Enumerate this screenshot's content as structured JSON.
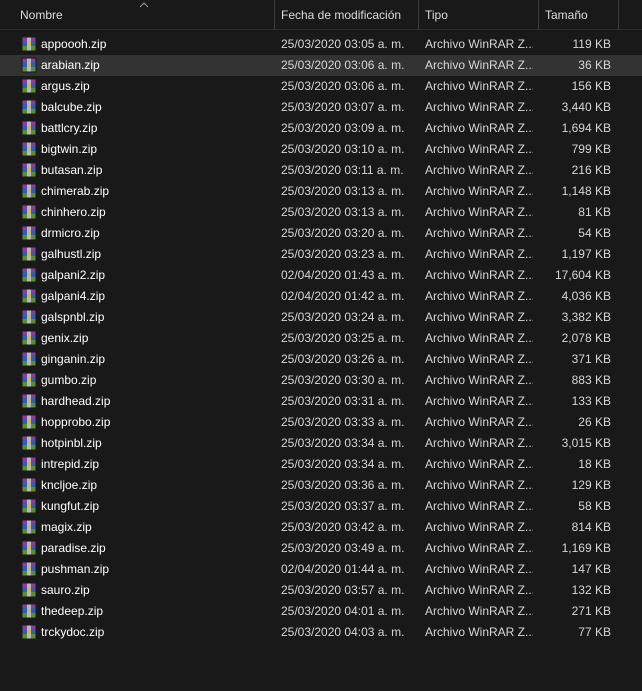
{
  "columns": {
    "name": "Nombre",
    "date": "Fecha de modificación",
    "type": "Tipo",
    "size": "Tamaño"
  },
  "sort": {
    "column": "name",
    "direction": "ascending",
    "icon": "chevron-up-icon"
  },
  "file_icon": "winrar-archive-icon",
  "selected_index": 1,
  "files": [
    {
      "name": "appoooh.zip",
      "date": "25/03/2020 03:05 a. m.",
      "type": "Archivo WinRAR Z...",
      "size": "119 KB"
    },
    {
      "name": "arabian.zip",
      "date": "25/03/2020 03:06 a. m.",
      "type": "Archivo WinRAR Z...",
      "size": "36 KB"
    },
    {
      "name": "argus.zip",
      "date": "25/03/2020 03:06 a. m.",
      "type": "Archivo WinRAR Z...",
      "size": "156 KB"
    },
    {
      "name": "balcube.zip",
      "date": "25/03/2020 03:07 a. m.",
      "type": "Archivo WinRAR Z...",
      "size": "3,440 KB"
    },
    {
      "name": "battlcry.zip",
      "date": "25/03/2020 03:09 a. m.",
      "type": "Archivo WinRAR Z...",
      "size": "1,694 KB"
    },
    {
      "name": "bigtwin.zip",
      "date": "25/03/2020 03:10 a. m.",
      "type": "Archivo WinRAR Z...",
      "size": "799 KB"
    },
    {
      "name": "butasan.zip",
      "date": "25/03/2020 03:11 a. m.",
      "type": "Archivo WinRAR Z...",
      "size": "216 KB"
    },
    {
      "name": "chimerab.zip",
      "date": "25/03/2020 03:13 a. m.",
      "type": "Archivo WinRAR Z...",
      "size": "1,148 KB"
    },
    {
      "name": "chinhero.zip",
      "date": "25/03/2020 03:13 a. m.",
      "type": "Archivo WinRAR Z...",
      "size": "81 KB"
    },
    {
      "name": "drmicro.zip",
      "date": "25/03/2020 03:20 a. m.",
      "type": "Archivo WinRAR Z...",
      "size": "54 KB"
    },
    {
      "name": "galhustl.zip",
      "date": "25/03/2020 03:23 a. m.",
      "type": "Archivo WinRAR Z...",
      "size": "1,197 KB"
    },
    {
      "name": "galpani2.zip",
      "date": "02/04/2020 01:43 a. m.",
      "type": "Archivo WinRAR Z...",
      "size": "17,604 KB"
    },
    {
      "name": "galpani4.zip",
      "date": "02/04/2020 01:42 a. m.",
      "type": "Archivo WinRAR Z...",
      "size": "4,036 KB"
    },
    {
      "name": "galspnbl.zip",
      "date": "25/03/2020 03:24 a. m.",
      "type": "Archivo WinRAR Z...",
      "size": "3,382 KB"
    },
    {
      "name": "genix.zip",
      "date": "25/03/2020 03:25 a. m.",
      "type": "Archivo WinRAR Z...",
      "size": "2,078 KB"
    },
    {
      "name": "ginganin.zip",
      "date": "25/03/2020 03:26 a. m.",
      "type": "Archivo WinRAR Z...",
      "size": "371 KB"
    },
    {
      "name": "gumbo.zip",
      "date": "25/03/2020 03:30 a. m.",
      "type": "Archivo WinRAR Z...",
      "size": "883 KB"
    },
    {
      "name": "hardhead.zip",
      "date": "25/03/2020 03:31 a. m.",
      "type": "Archivo WinRAR Z...",
      "size": "133 KB"
    },
    {
      "name": "hopprobo.zip",
      "date": "25/03/2020 03:33 a. m.",
      "type": "Archivo WinRAR Z...",
      "size": "26 KB"
    },
    {
      "name": "hotpinbl.zip",
      "date": "25/03/2020 03:34 a. m.",
      "type": "Archivo WinRAR Z...",
      "size": "3,015 KB"
    },
    {
      "name": "intrepid.zip",
      "date": "25/03/2020 03:34 a. m.",
      "type": "Archivo WinRAR Z...",
      "size": "18 KB"
    },
    {
      "name": "kncljoe.zip",
      "date": "25/03/2020 03:36 a. m.",
      "type": "Archivo WinRAR Z...",
      "size": "129 KB"
    },
    {
      "name": "kungfut.zip",
      "date": "25/03/2020 03:37 a. m.",
      "type": "Archivo WinRAR Z...",
      "size": "58 KB"
    },
    {
      "name": "magix.zip",
      "date": "25/03/2020 03:42 a. m.",
      "type": "Archivo WinRAR Z...",
      "size": "814 KB"
    },
    {
      "name": "paradise.zip",
      "date": "25/03/2020 03:49 a. m.",
      "type": "Archivo WinRAR Z...",
      "size": "1,169 KB"
    },
    {
      "name": "pushman.zip",
      "date": "02/04/2020 01:44 a. m.",
      "type": "Archivo WinRAR Z...",
      "size": "147 KB"
    },
    {
      "name": "sauro.zip",
      "date": "25/03/2020 03:57 a. m.",
      "type": "Archivo WinRAR Z...",
      "size": "132 KB"
    },
    {
      "name": "thedeep.zip",
      "date": "25/03/2020 04:01 a. m.",
      "type": "Archivo WinRAR Z...",
      "size": "271 KB"
    },
    {
      "name": "trckydoc.zip",
      "date": "25/03/2020 04:03 a. m.",
      "type": "Archivo WinRAR Z...",
      "size": "77 KB"
    }
  ]
}
